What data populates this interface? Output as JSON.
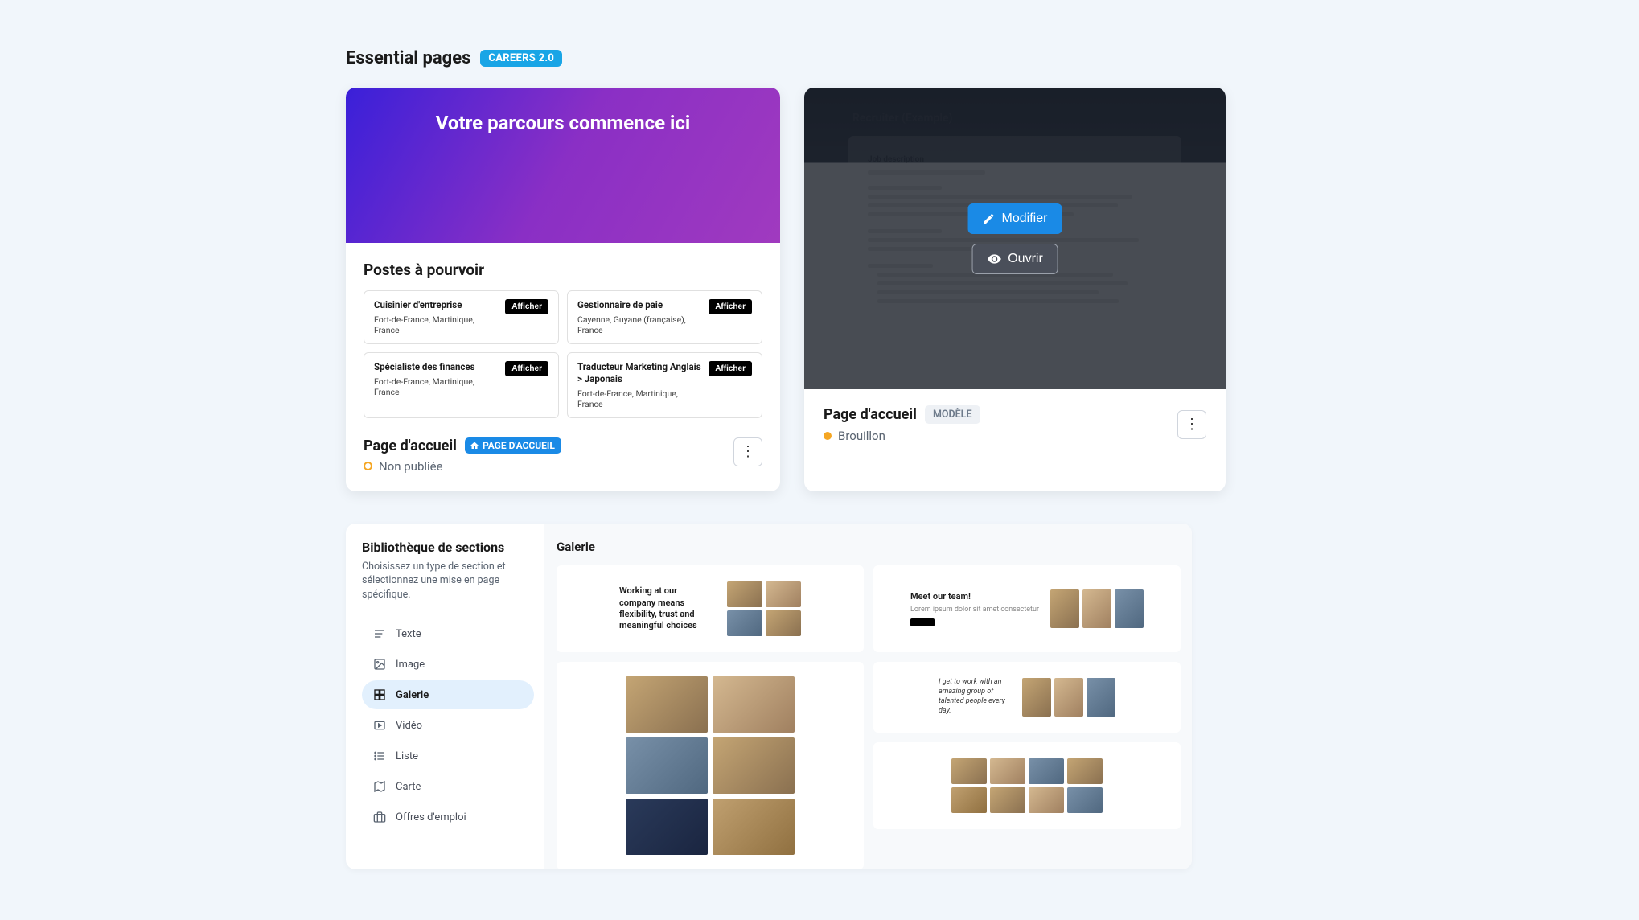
{
  "header": {
    "title": "Essential pages",
    "badge": "CAREERS 2.0"
  },
  "card_left": {
    "hero_text": "Votre parcours commence ici",
    "jobs_title": "Postes à pourvoir",
    "jobs": [
      {
        "title": "Cuisinier d'entreprise",
        "location": "Fort-de-France, Martinique, France",
        "btn": "Afficher"
      },
      {
        "title": "Gestionnaire de paie",
        "location": "Cayenne, Guyane (française), France",
        "btn": "Afficher"
      },
      {
        "title": "Spécialiste des finances",
        "location": "Fort-de-France, Martinique, France",
        "btn": "Afficher"
      },
      {
        "title": "Traducteur Marketing Anglais > Japonais",
        "location": "Fort-de-France, Martinique, France",
        "btn": "Afficher"
      }
    ],
    "footer_title": "Page d'accueil",
    "footer_badge": "PAGE D'ACCUEIL",
    "status": "Non publiée"
  },
  "card_right": {
    "modify_btn": "Modifier",
    "open_btn": "Ouvrir",
    "footer_title": "Page d'accueil",
    "footer_badge": "MODÈLE",
    "status": "Brouillon",
    "doc_heading": "Recruiter (Example)",
    "doc_section": "Job description"
  },
  "library": {
    "title": "Bibliothèque de sections",
    "description": "Choisissez un type de section et sélectionnez une mise en page spécifique.",
    "items": [
      {
        "label": "Texte",
        "active": false,
        "icon": "text"
      },
      {
        "label": "Image",
        "active": false,
        "icon": "image"
      },
      {
        "label": "Galerie",
        "active": true,
        "icon": "gallery"
      },
      {
        "label": "Vidéo",
        "active": false,
        "icon": "video"
      },
      {
        "label": "Liste",
        "active": false,
        "icon": "list"
      },
      {
        "label": "Carte",
        "active": false,
        "icon": "map"
      },
      {
        "label": "Offres d'emploi",
        "active": false,
        "icon": "jobs"
      }
    ],
    "content_title": "Galerie",
    "tile1_text": "Working at our company means flexibility, trust and meaningful choices",
    "tile2_text": "Meet our team!",
    "tile3_quote": "I get to work with an amazing group of talented people every day."
  }
}
